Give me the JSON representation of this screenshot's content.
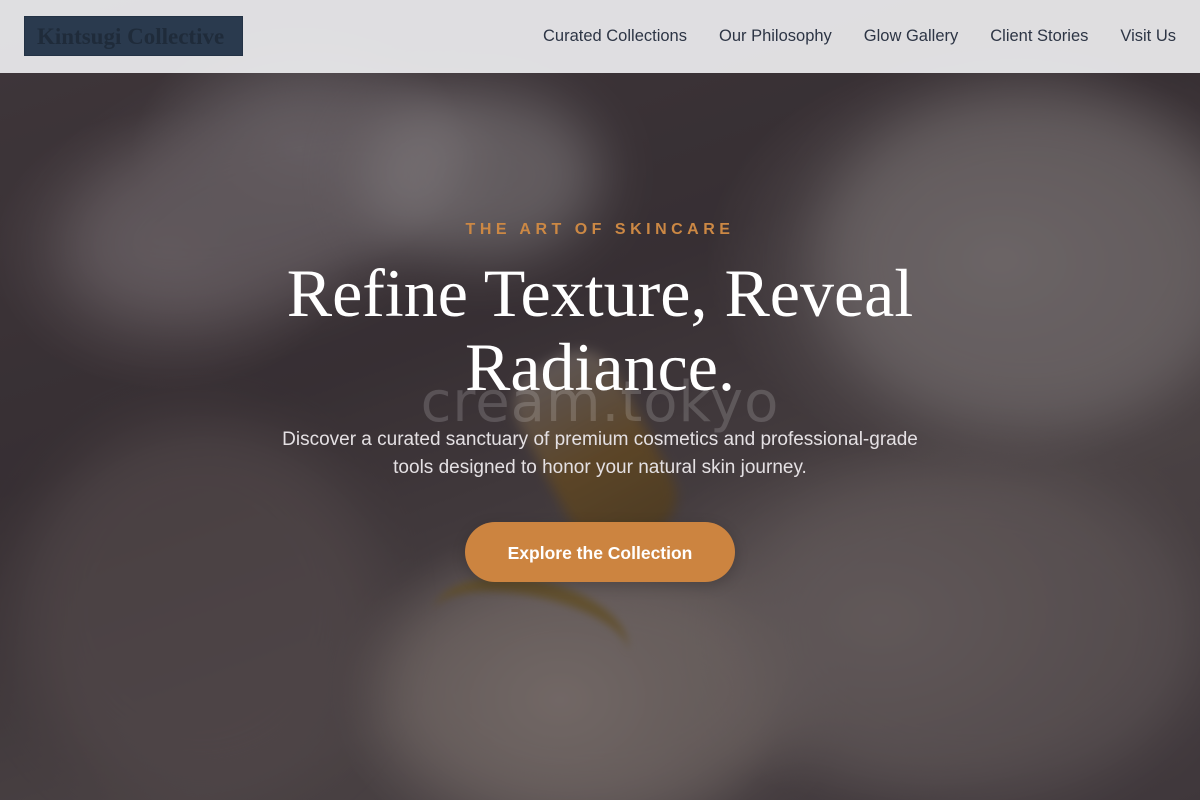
{
  "header": {
    "logo_text": "Kintsugi Collective",
    "nav": [
      {
        "label": "Curated Collections"
      },
      {
        "label": "Our Philosophy"
      },
      {
        "label": "Glow Gallery"
      },
      {
        "label": "Client Stories"
      },
      {
        "label": "Visit Us"
      }
    ]
  },
  "hero": {
    "eyebrow": "THE ART OF SKINCARE",
    "headline": "Refine Texture, Reveal Radiance.",
    "subtitle": "Discover a curated sanctuary of premium cosmetics and professional-grade tools designed to honor your natural skin journey.",
    "cta_label": "Explore the Collection",
    "watermark": "cream.tokyo"
  },
  "colors": {
    "accent": "#cc8844",
    "logo_bg": "#2a3a4e",
    "header_bg": "#ececee",
    "nav_text": "#2d3545"
  }
}
